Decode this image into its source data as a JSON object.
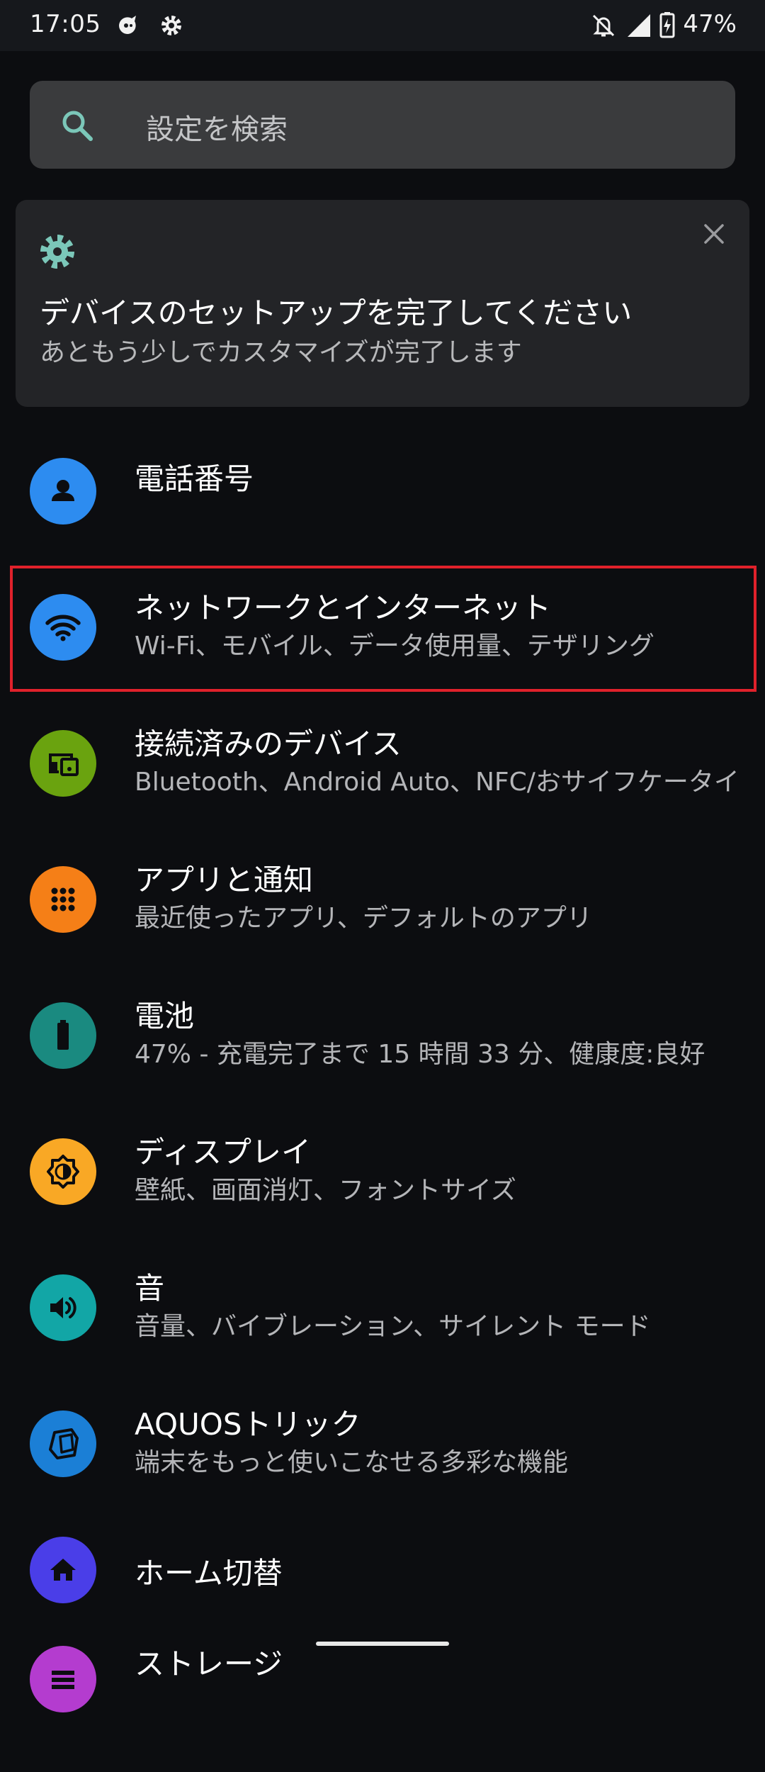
{
  "status_bar": {
    "time": "17:05",
    "battery_text": "47%"
  },
  "search": {
    "placeholder": "設定を検索"
  },
  "setup_card": {
    "title": "デバイスのセットアップを完了してください",
    "subtitle": "あともう少しでカスタマイズが完了します"
  },
  "settings": {
    "items": [
      {
        "title": "電話番号",
        "subtitle": "",
        "icon": "person-icon",
        "color": "#2d8cf0"
      },
      {
        "title": "ネットワークとインターネット",
        "subtitle": "Wi-Fi、モバイル、データ使用量、テザリング",
        "icon": "wifi-icon",
        "color": "#2d8cf0"
      },
      {
        "title": "接続済みのデバイス",
        "subtitle": "Bluetooth、Android Auto、NFC/おサイフケータイ",
        "icon": "devices-icon",
        "color": "#6aa30f"
      },
      {
        "title": "アプリと通知",
        "subtitle": "最近使ったアプリ、デフォルトのアプリ",
        "icon": "apps-grid-icon",
        "color": "#f57f17"
      },
      {
        "title": "電池",
        "subtitle": "47% - 充電完了まで 15 時間 33 分、健康度:良好",
        "icon": "battery-icon",
        "color": "#1a8a80"
      },
      {
        "title": "ディスプレイ",
        "subtitle": "壁紙、画面消灯、フォントサイズ",
        "icon": "brightness-icon",
        "color": "#f9a825"
      },
      {
        "title": "音",
        "subtitle": "音量、バイブレーション、サイレント モード",
        "icon": "volume-icon",
        "color": "#12a6a6"
      },
      {
        "title": "AQUOSトリック",
        "subtitle": "端末をもっと使いこなせる多彩な機能",
        "icon": "cube-icon",
        "color": "#1b7fd6"
      },
      {
        "title": "ホーム切替",
        "subtitle": "",
        "icon": "home-icon",
        "color": "#4a3ee8"
      },
      {
        "title": "ストレージ",
        "subtitle": "",
        "icon": "storage-icon",
        "color": "#b43ccf"
      }
    ]
  },
  "colors": {
    "accent": "#7bc7b9",
    "highlight_border": "#e0212b"
  }
}
